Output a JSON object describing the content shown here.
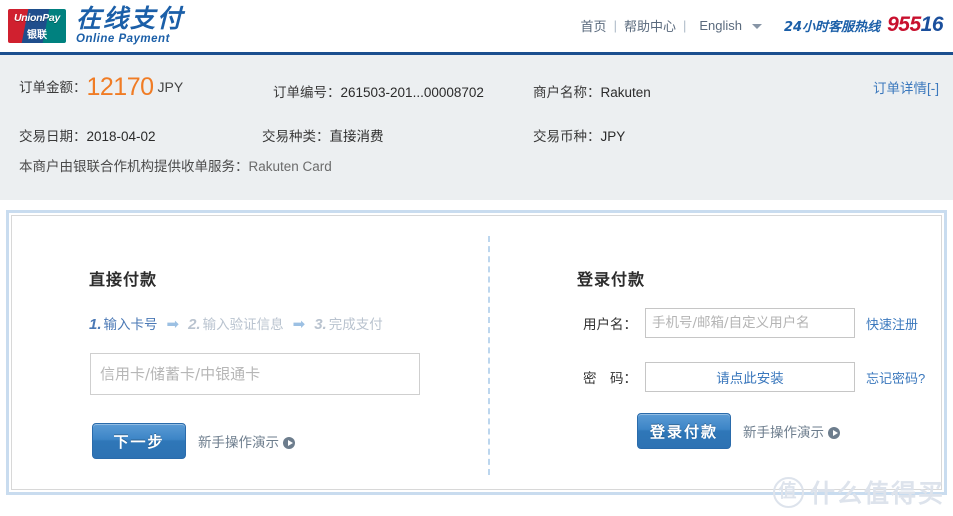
{
  "header": {
    "logo": {
      "word": "UnionPay",
      "cn": "银联",
      "colors": {
        "red": "#d0202f",
        "blue": "#1f4e8c",
        "teal": "#00817f"
      }
    },
    "brand_cn": "在线支付",
    "brand_en": "Online  Payment",
    "nav": {
      "home": "首页",
      "sep1": "|",
      "help": "帮助中心",
      "sep2": "|",
      "language": "English"
    },
    "hotline_label": "24小时客服热线",
    "hotline_number_a": "955",
    "hotline_number_b": "16",
    "accent": "#1b4f8f"
  },
  "order": {
    "amount_label": "订单金额：",
    "amount_value": "12170",
    "amount_currency": "JPY",
    "amount_color": "#f07c25",
    "order_no_label": "订单编号：",
    "order_no_value": "261503-201...00008702",
    "merchant_label": "商户名称：",
    "merchant_value": "Rakuten",
    "date_label": "交易日期：",
    "date_value": "2018-04-02",
    "type_label": "交易种类：",
    "type_value": "直接消费",
    "currency_label": "交易币种：",
    "currency_value": "JPY",
    "note_prefix": "本商户由银联合作机构提供收单服务：",
    "note_merchant": "Rakuten Card",
    "detail_link": "订单详情[-]"
  },
  "direct": {
    "title": "直接付款",
    "steps": [
      {
        "num": "1.",
        "text": "输入卡号",
        "state": "active"
      },
      {
        "num": "2.",
        "text": "输入验证信息",
        "state": "idle"
      },
      {
        "num": "3.",
        "text": "完成支付",
        "state": "idle"
      }
    ],
    "arrow": "➡",
    "card_placeholder": "信用卡/储蓄卡/中银通卡",
    "card_value": "",
    "next_button": "下一步",
    "demo_link": "新手操作演示"
  },
  "login": {
    "title": "登录付款",
    "username_label": "用户名：",
    "username_placeholder": "手机号/邮箱/自定义用户名",
    "username_value": "",
    "register_link": "快速注册",
    "password_label": "密　码：",
    "password_install_text": "请点此安装",
    "forgot_link": "忘记密码?",
    "login_button": "登录付款",
    "demo_link": "新手操作演示"
  },
  "watermark": {
    "mark": "值",
    "text": "什么值得买"
  }
}
